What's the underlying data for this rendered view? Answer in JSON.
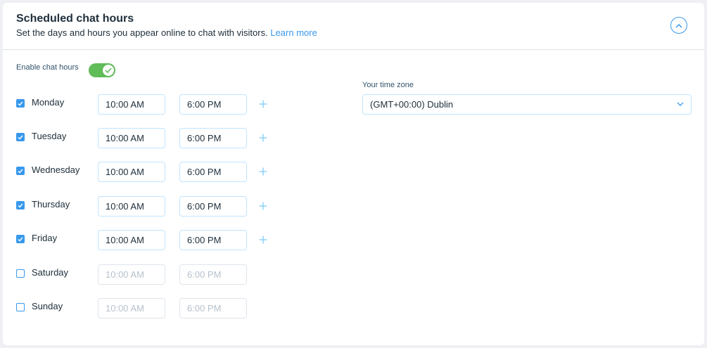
{
  "header": {
    "title": "Scheduled chat hours",
    "subtitle": "Set the days and hours you appear online to chat with visitors.",
    "learn_more": "Learn more",
    "collapse_icon": "chevron-up-icon"
  },
  "enable": {
    "label": "Enable chat hours",
    "enabled": true
  },
  "days": [
    {
      "name": "Monday",
      "checked": true,
      "from": "10:00 AM",
      "to": "6:00 PM"
    },
    {
      "name": "Tuesday",
      "checked": true,
      "from": "10:00 AM",
      "to": "6:00 PM"
    },
    {
      "name": "Wednesday",
      "checked": true,
      "from": "10:00 AM",
      "to": "6:00 PM"
    },
    {
      "name": "Thursday",
      "checked": true,
      "from": "10:00 AM",
      "to": "6:00 PM"
    },
    {
      "name": "Friday",
      "checked": true,
      "from": "10:00 AM",
      "to": "6:00 PM"
    },
    {
      "name": "Saturday",
      "checked": false,
      "from": "10:00 AM",
      "to": "6:00 PM"
    },
    {
      "name": "Sunday",
      "checked": false,
      "from": "10:00 AM",
      "to": "6:00 PM"
    }
  ],
  "timezone": {
    "label": "Your time zone",
    "value": "(GMT+00:00) Dublin"
  },
  "colors": {
    "accent": "#3899ec",
    "toggle_on": "#60bc57",
    "text": "#20303c",
    "disabled_text": "#b6c1cd"
  }
}
